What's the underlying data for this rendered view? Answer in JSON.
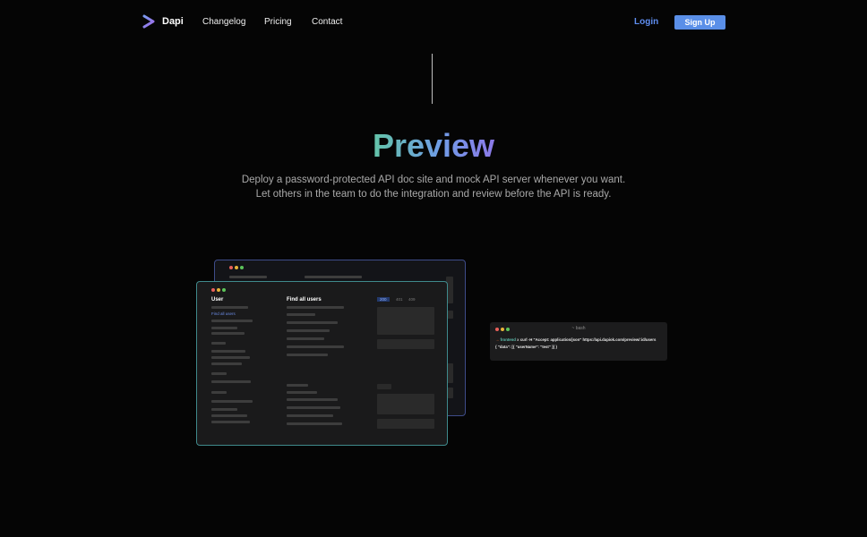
{
  "nav": {
    "brand": "Dapi",
    "links": [
      "Changelog",
      "Pricing",
      "Contact"
    ],
    "login": "Login",
    "signup": "Sign Up"
  },
  "hero": {
    "title": "Preview",
    "subtitle_line1": "Deploy a password-protected API doc site and mock API server whenever you want.",
    "subtitle_line2": "Let others in the team to do the integration and review before the API is ready."
  },
  "mock_front": {
    "sidebar_title": "User",
    "sidebar_link": "Find all users",
    "content_title": "Find all users",
    "tabs": [
      "200",
      "401",
      "409"
    ]
  },
  "terminal": {
    "title": "~ bash",
    "prompt_arrow": "→",
    "prompt_dir": "frontend",
    "prompt_mark": "x",
    "command": "curl -H \"Accept: application/json\" https://api.dapiok.com/preview/:id/users",
    "output": "{ \"data\": [{ \"userName\": \"test\" }] }"
  },
  "colors": {
    "accent": "#5a8fe8",
    "gradient_start": "#63c4a8",
    "gradient_end": "#8b79e8",
    "dot_red": "#e8605a",
    "dot_yellow": "#e8b43a",
    "dot_green": "#5cc45a"
  }
}
